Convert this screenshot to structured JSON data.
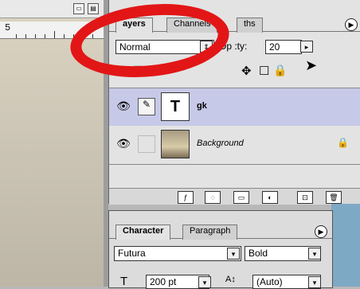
{
  "document": {
    "ruler_label": "5"
  },
  "layers_palette": {
    "tabs": [
      "ayers",
      "Channels",
      "ths"
    ],
    "blend_mode": "Normal",
    "opacity_label": "Op     :ty:",
    "opacity_value": "20",
    "lock_label": "k:",
    "layers": [
      {
        "name": "gk",
        "thumb": "T"
      },
      {
        "name": "Background"
      }
    ],
    "bottom_icons": [
      "layer-effects-icon",
      "mask-icon",
      "folder-icon",
      "adjustment-icon",
      "new-layer-icon",
      "trash-icon"
    ]
  },
  "character_palette": {
    "tabs": [
      "Character",
      "Paragraph"
    ],
    "font_family": "Futura",
    "font_style": "Bold",
    "font_size": "200 pt",
    "leading": "(Auto)"
  },
  "annotation_color": "#e21616",
  "selected_layer_color": "#c7c9e8"
}
